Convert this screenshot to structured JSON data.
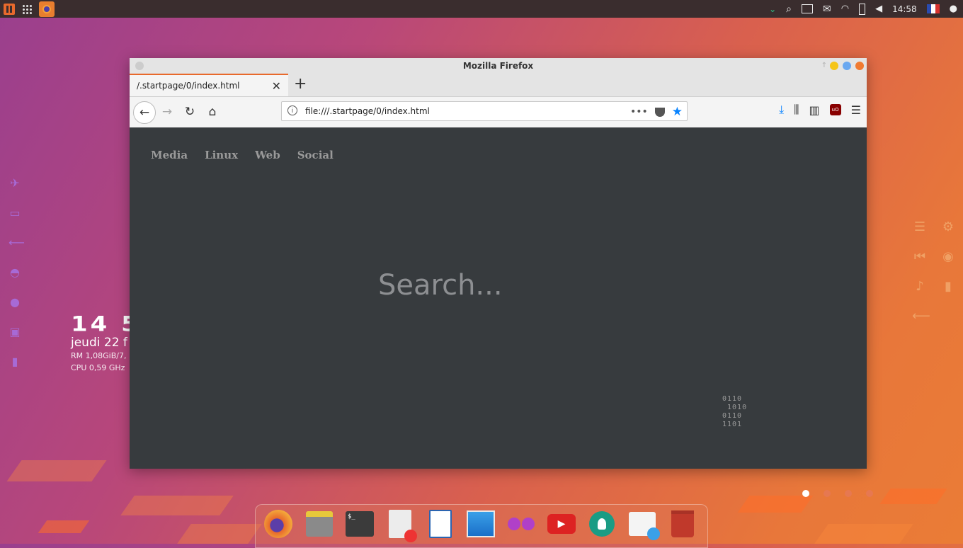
{
  "top_panel": {
    "clock": "14:58",
    "icons": [
      "app-menu-icon",
      "app-grid-icon",
      "firefox-task-icon",
      "chevron-down-icon",
      "search-icon",
      "window-icon",
      "mail-icon",
      "wifi-icon",
      "battery-icon",
      "volume-icon",
      "flag-fr-icon",
      "user-icon"
    ]
  },
  "conky": {
    "time": "14 5",
    "date": "jeudi 22 f",
    "ram": "RM 1,08GiB/7,",
    "cpu": "CPU 0,59 GHz"
  },
  "firefox": {
    "window_title": "Mozilla Firefox",
    "tab_title": "/.startpage/0/index.html",
    "url": "file:///.startpage/0/index.html",
    "new_tab_glyph": "+",
    "close_tab_glyph": "✕"
  },
  "startpage": {
    "links": [
      "Media",
      "Linux",
      "Web",
      "Social"
    ],
    "search_placeholder": "Search...",
    "binary_art": "0110\n 1010\n0110\n1101"
  },
  "workspaces": {
    "count": 4,
    "active": 0
  },
  "dock": {
    "items": [
      "firefox",
      "files",
      "terminal",
      "text-editor",
      "writer",
      "screenshot",
      "music",
      "youtube",
      "settings",
      "software-store",
      "trash"
    ]
  },
  "colors": {
    "accent": "#e8692c",
    "window_bg": "#373b3e",
    "link_blue": "#0a84ff"
  }
}
